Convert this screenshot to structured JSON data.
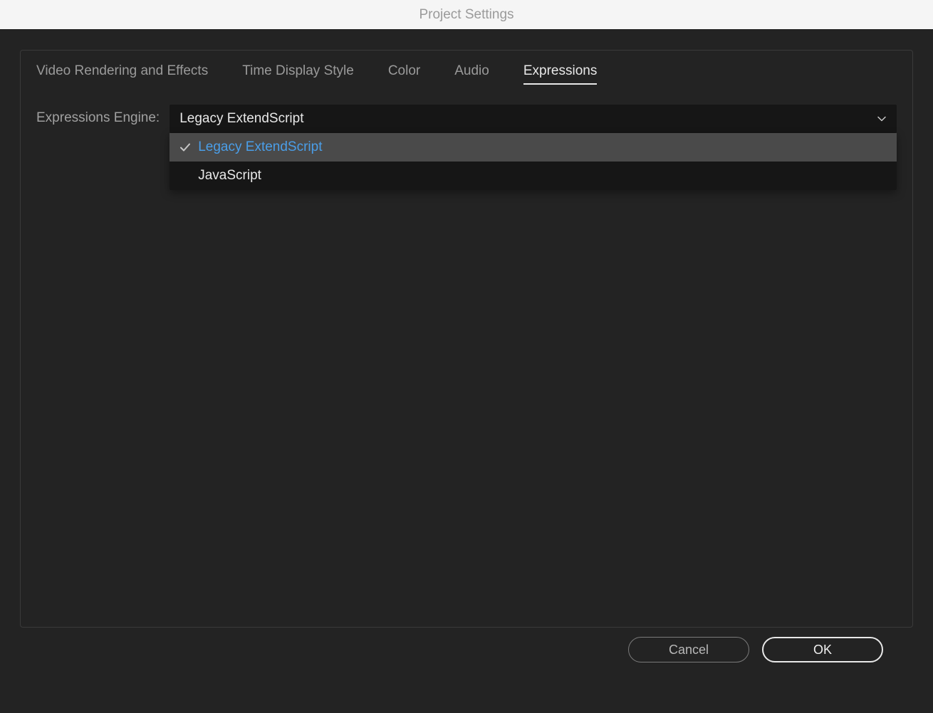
{
  "window": {
    "title": "Project Settings"
  },
  "tabs": {
    "items": [
      {
        "label": "Video Rendering and Effects"
      },
      {
        "label": "Time Display Style"
      },
      {
        "label": "Color"
      },
      {
        "label": "Audio"
      },
      {
        "label": "Expressions"
      }
    ],
    "active_index": 4
  },
  "form": {
    "engine_label": "Expressions Engine:",
    "engine_selected": "Legacy ExtendScript",
    "engine_options": [
      {
        "label": "Legacy ExtendScript",
        "selected": true
      },
      {
        "label": "JavaScript",
        "selected": false
      }
    ]
  },
  "footer": {
    "cancel_label": "Cancel",
    "ok_label": "OK"
  }
}
